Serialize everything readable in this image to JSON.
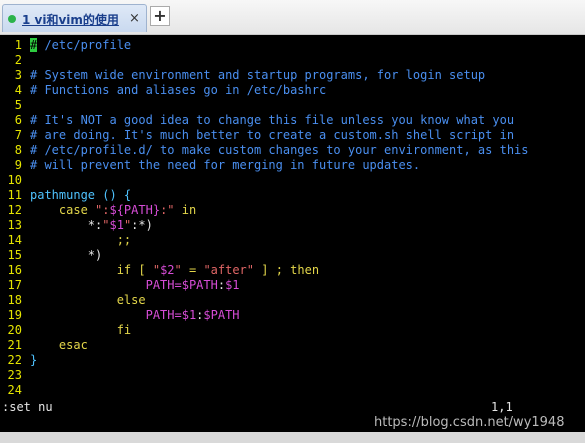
{
  "tab": {
    "label": "1 vi和vim的使用",
    "close_label": "×",
    "add_label": "+"
  },
  "editor": {
    "lines": [
      {
        "n": "1",
        "segs": [
          {
            "t": "#",
            "c": "cursor"
          },
          {
            "t": " /etc/profile",
            "c": "c-comment"
          }
        ]
      },
      {
        "n": "2",
        "segs": []
      },
      {
        "n": "3",
        "segs": [
          {
            "t": "# System wide environment and startup programs, for login setup",
            "c": "c-comment"
          }
        ]
      },
      {
        "n": "4",
        "segs": [
          {
            "t": "# Functions and aliases go in /etc/bashrc",
            "c": "c-comment"
          }
        ]
      },
      {
        "n": "5",
        "segs": []
      },
      {
        "n": "6",
        "segs": [
          {
            "t": "# It's NOT a good idea to change this file unless you know what you",
            "c": "c-comment"
          }
        ]
      },
      {
        "n": "7",
        "segs": [
          {
            "t": "# are doing. It's much better to create a custom.sh shell script in",
            "c": "c-comment"
          }
        ]
      },
      {
        "n": "8",
        "segs": [
          {
            "t": "# /etc/profile.d/ to make custom changes to your environment, as this",
            "c": "c-comment"
          }
        ]
      },
      {
        "n": "9",
        "segs": [
          {
            "t": "# will prevent the need for merging in future updates.",
            "c": "c-comment"
          }
        ]
      },
      {
        "n": "10",
        "segs": []
      },
      {
        "n": "11",
        "segs": [
          {
            "t": "pathmunge () {",
            "c": "c-func"
          }
        ]
      },
      {
        "n": "12",
        "segs": [
          {
            "t": "    case ",
            "c": "c-kw"
          },
          {
            "t": "\":",
            "c": "c-str"
          },
          {
            "t": "${PATH}",
            "c": "c-var"
          },
          {
            "t": ":\"",
            "c": "c-str"
          },
          {
            "t": " in",
            "c": "c-kw"
          }
        ]
      },
      {
        "n": "13",
        "segs": [
          {
            "t": "        *:",
            "c": "c-plain"
          },
          {
            "t": "\"",
            "c": "c-str"
          },
          {
            "t": "$1",
            "c": "c-var"
          },
          {
            "t": "\"",
            "c": "c-str"
          },
          {
            "t": ":*)",
            "c": "c-plain"
          }
        ]
      },
      {
        "n": "14",
        "segs": [
          {
            "t": "            ;;",
            "c": "c-kw"
          }
        ]
      },
      {
        "n": "15",
        "segs": [
          {
            "t": "        *)",
            "c": "c-plain"
          }
        ]
      },
      {
        "n": "16",
        "segs": [
          {
            "t": "            if [ ",
            "c": "c-kw"
          },
          {
            "t": "\"",
            "c": "c-str"
          },
          {
            "t": "$2",
            "c": "c-var"
          },
          {
            "t": "\"",
            "c": "c-str"
          },
          {
            "t": " = ",
            "c": "c-kw"
          },
          {
            "t": "\"after\"",
            "c": "c-str"
          },
          {
            "t": " ] ; then",
            "c": "c-kw"
          }
        ]
      },
      {
        "n": "17",
        "segs": [
          {
            "t": "                PATH=",
            "c": "c-var"
          },
          {
            "t": "$PATH",
            "c": "c-var"
          },
          {
            "t": ":",
            "c": "c-plain"
          },
          {
            "t": "$1",
            "c": "c-var"
          }
        ]
      },
      {
        "n": "18",
        "segs": [
          {
            "t": "            else",
            "c": "c-kw"
          }
        ]
      },
      {
        "n": "19",
        "segs": [
          {
            "t": "                PATH=",
            "c": "c-var"
          },
          {
            "t": "$1",
            "c": "c-var"
          },
          {
            "t": ":",
            "c": "c-plain"
          },
          {
            "t": "$PATH",
            "c": "c-var"
          }
        ]
      },
      {
        "n": "20",
        "segs": [
          {
            "t": "            fi",
            "c": "c-kw"
          }
        ]
      },
      {
        "n": "21",
        "segs": [
          {
            "t": "    esac",
            "c": "c-kw"
          }
        ]
      },
      {
        "n": "22",
        "segs": [
          {
            "t": "}",
            "c": "c-func"
          }
        ]
      },
      {
        "n": "23",
        "segs": []
      },
      {
        "n": "24",
        "segs": []
      }
    ]
  },
  "status": {
    "command": ":set nu",
    "position": "1,1"
  },
  "watermark": "https://blog.csdn.net/wy1948",
  "colors": {
    "line_number": "#e5e500",
    "comment": "#4a8ff0",
    "keyword": "#e3d64a",
    "string": "#e06666",
    "variable": "#d64cd6",
    "cursor": "#2ecc40"
  }
}
